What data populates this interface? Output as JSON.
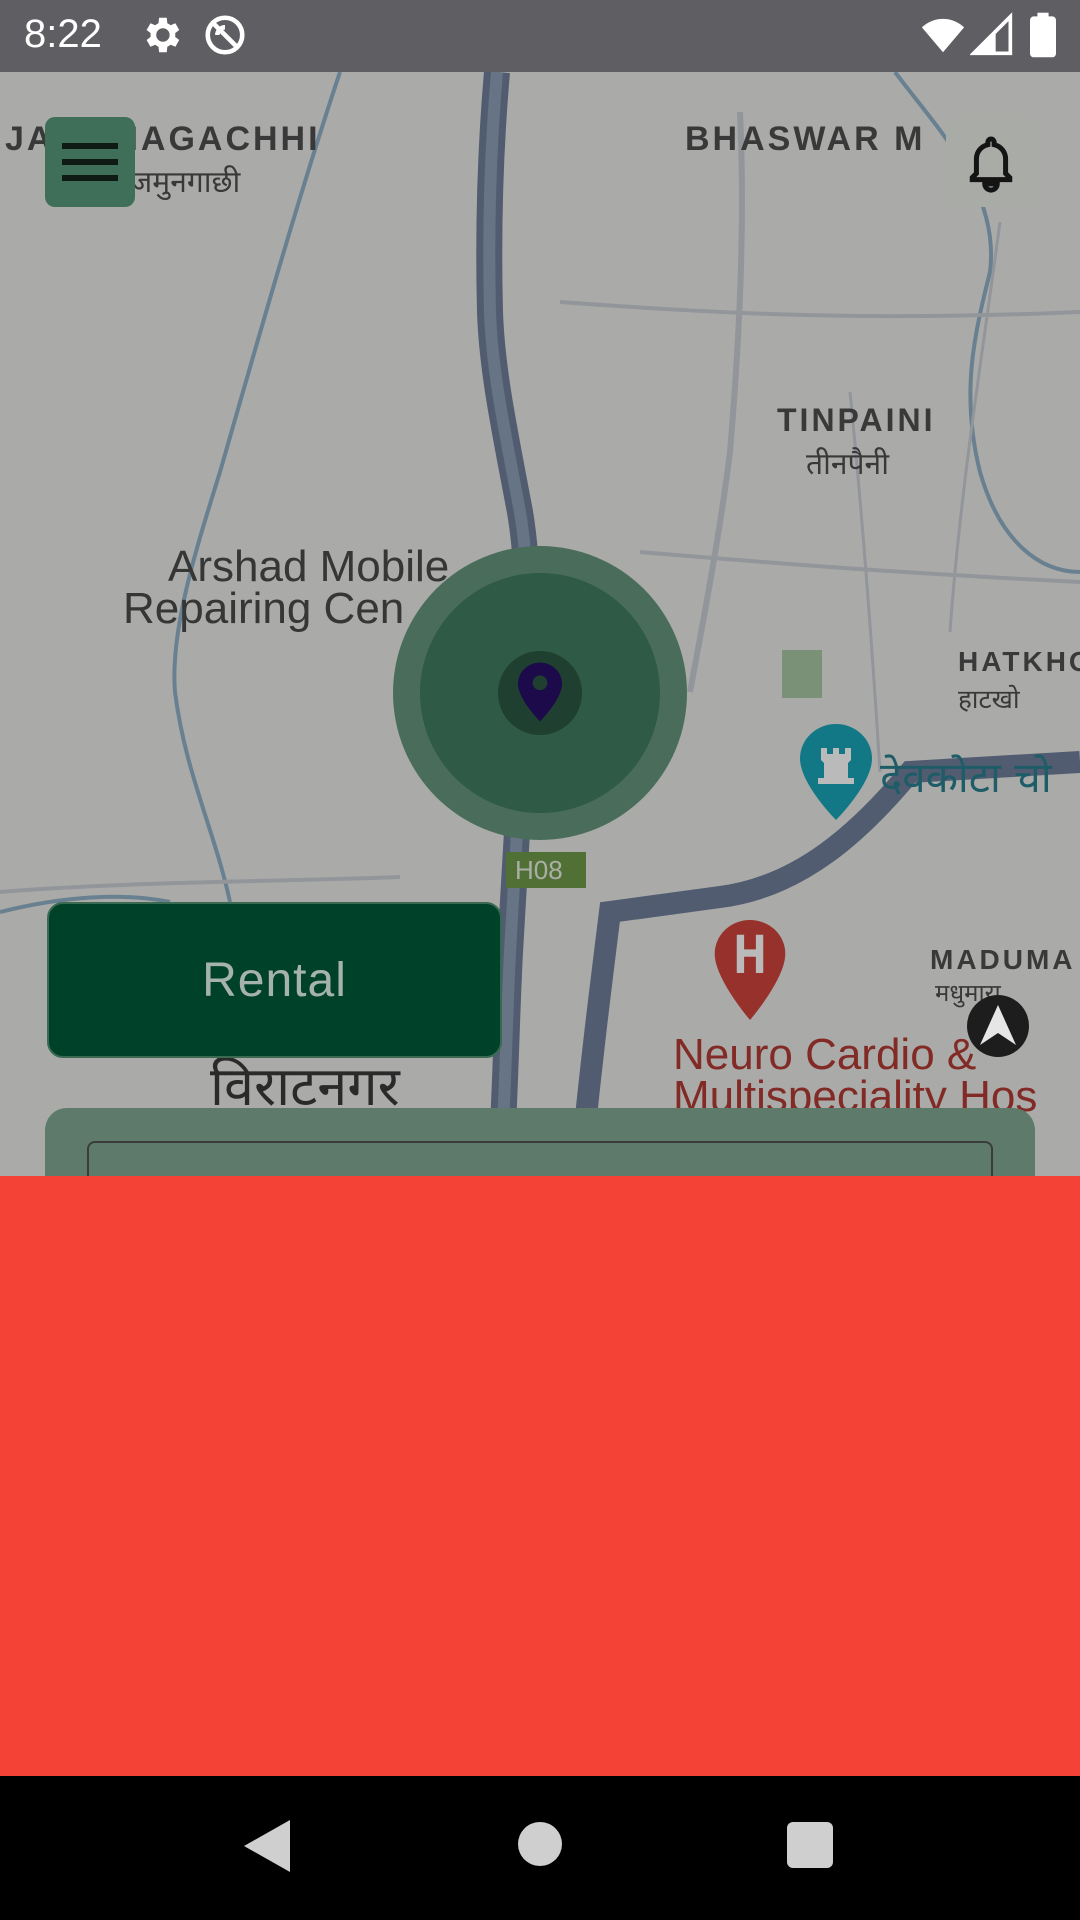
{
  "status_bar": {
    "time": "8:22",
    "icons": [
      "gear-icon",
      "do-not-disturb-icon",
      "wifi-icon",
      "signal-icon",
      "battery-icon"
    ]
  },
  "map": {
    "labels": [
      {
        "text": "JAMUNAGACHHI",
        "sub": "जमुनगाछी"
      },
      {
        "text": "BHASWAR M",
        "sub": ""
      },
      {
        "text": "TINPAINI",
        "sub": "तीनपैनी"
      },
      {
        "text": "HATKHO",
        "sub": "हाटखो"
      },
      {
        "text": "MADUMA",
        "sub": "मधुमारा"
      }
    ],
    "pois": {
      "arshad": [
        "Arshad Mobile",
        "Repairing Cen"
      ],
      "neuro": [
        "Neuro Cardio &",
        "Multispeciality Hos"
      ],
      "devkota": "देवकोटा चो",
      "city": "विराटनगर",
      "road_shield": "H08"
    }
  },
  "header": {
    "menu_icon": "hamburger-menu-icon",
    "bell_icon": "bell-icon"
  },
  "actions": {
    "rental_label": "Rental"
  },
  "colors": {
    "accent": "#004129",
    "alert_block": "#f44336",
    "status_bar": "#5f5e62"
  },
  "nav_bar": {
    "icons": [
      "back-icon",
      "home-icon",
      "recents-icon"
    ]
  }
}
